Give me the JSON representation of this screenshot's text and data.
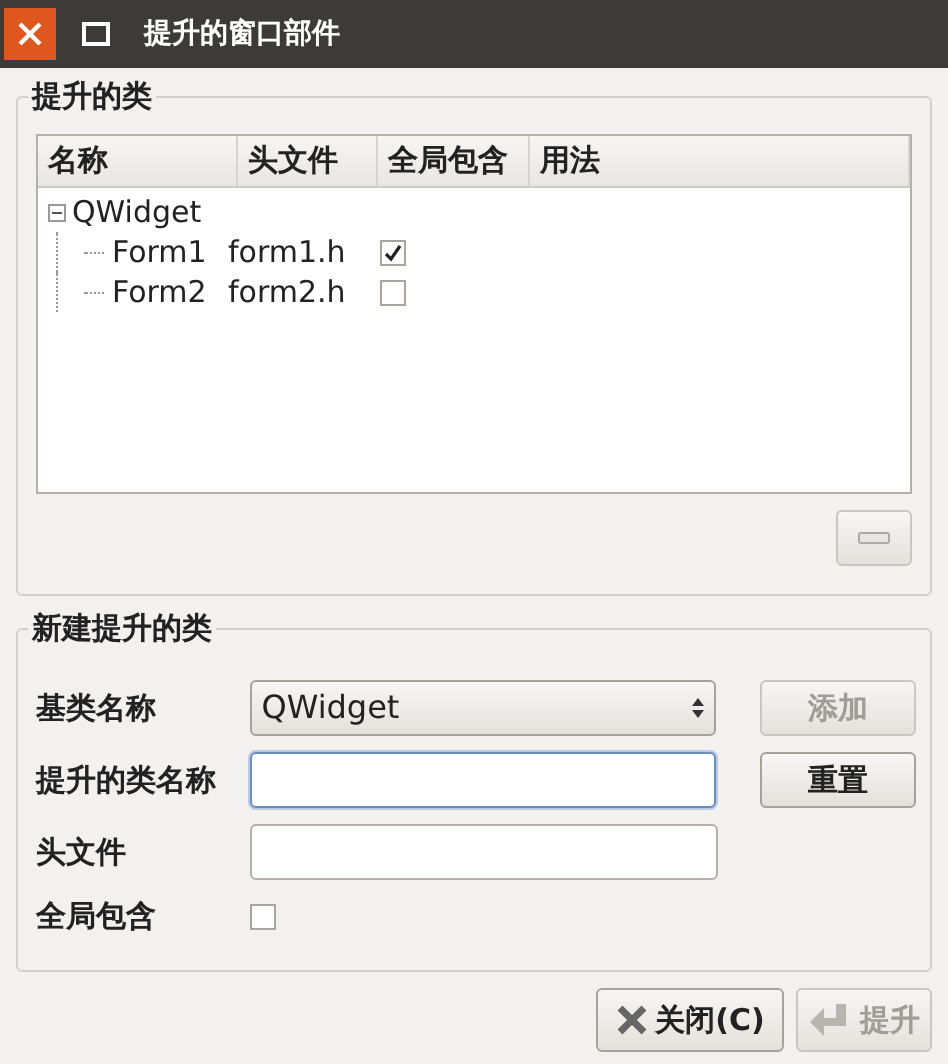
{
  "window": {
    "title": "提升的窗口部件"
  },
  "promoted_classes": {
    "title": "提升的类",
    "columns": [
      "名称",
      "头文件",
      "全局包含",
      "用法"
    ],
    "tree": [
      {
        "name": "QWidget",
        "expanded": true,
        "children": [
          {
            "name": "Form1",
            "header": "form1.h",
            "global_include": true
          },
          {
            "name": "Form2",
            "header": "form2.h",
            "global_include": false
          }
        ]
      }
    ],
    "remove_button": {
      "disabled": true
    }
  },
  "new_promoted_class": {
    "title": "新建提升的类",
    "base_class": {
      "label": "基类名称",
      "value": "QWidget"
    },
    "class_name": {
      "label": "提升的类名称",
      "focused": true
    },
    "header_file": {
      "label": "头文件"
    },
    "global_include": {
      "label": "全局包含",
      "checked": false
    },
    "add_button": {
      "label": "添加",
      "disabled": true
    },
    "reset_button": {
      "label": "重置",
      "disabled": false
    }
  },
  "buttons": [
    {
      "kind": "close",
      "label": "关闭(C)",
      "disabled": false
    },
    {
      "kind": "promote",
      "label": "提升",
      "disabled": true
    }
  ]
}
